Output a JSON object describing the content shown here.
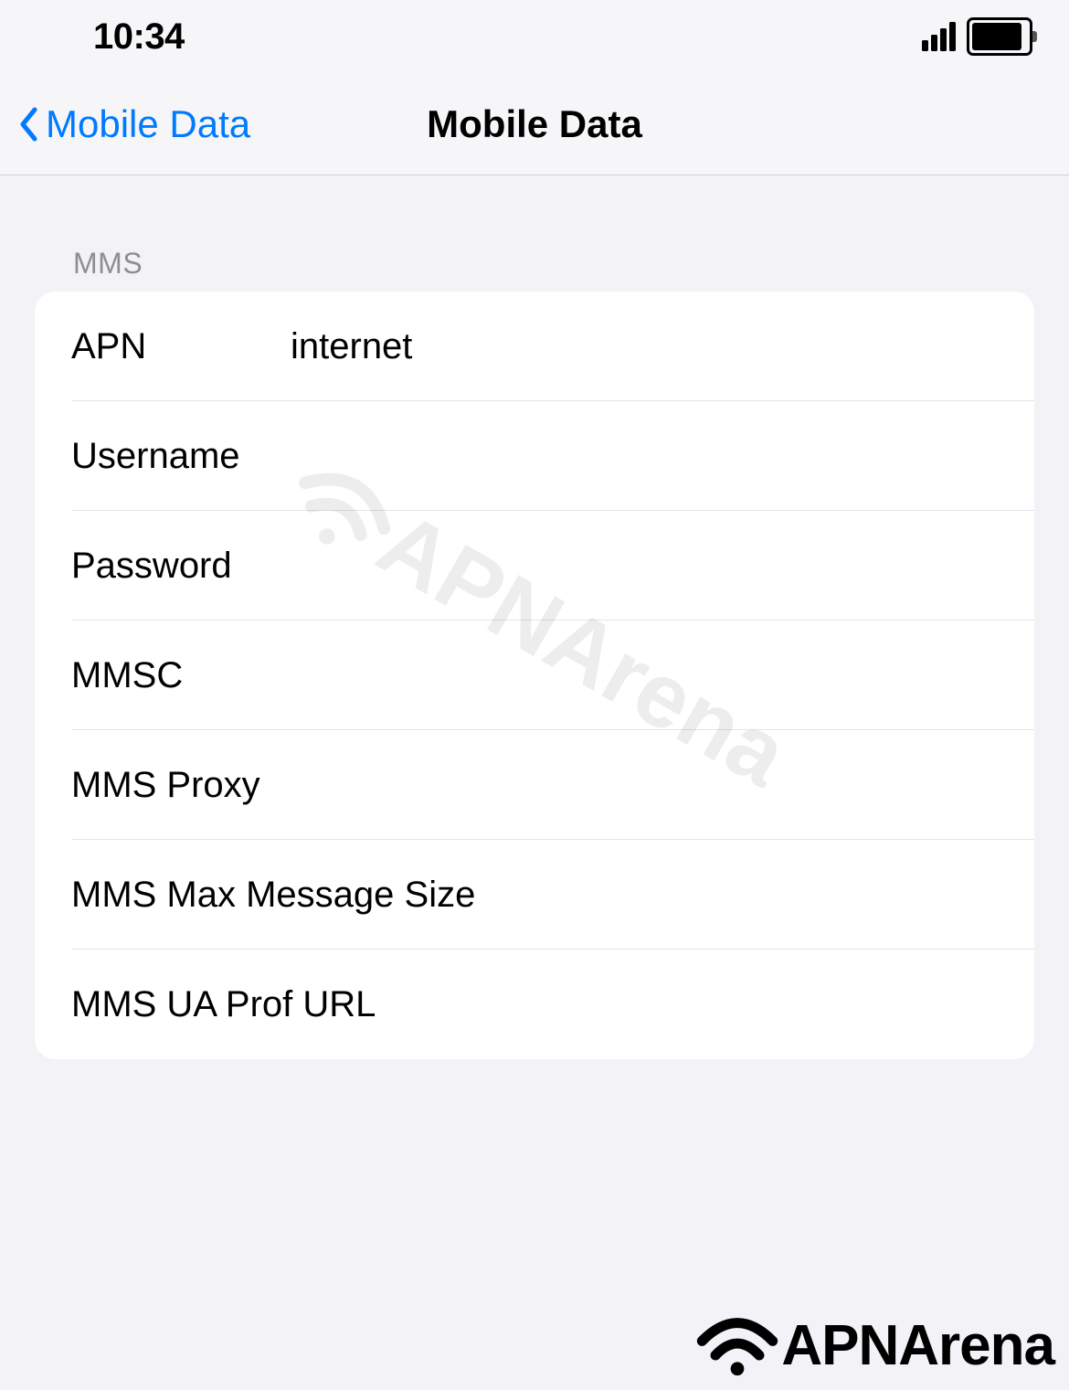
{
  "statusBar": {
    "time": "10:34"
  },
  "nav": {
    "backLabel": "Mobile Data",
    "title": "Mobile Data"
  },
  "section": {
    "header": "MMS",
    "rows": {
      "apn": {
        "label": "APN",
        "value": "internet"
      },
      "username": {
        "label": "Username",
        "value": ""
      },
      "password": {
        "label": "Password",
        "value": ""
      },
      "mmsc": {
        "label": "MMSC",
        "value": ""
      },
      "mmsProxy": {
        "label": "MMS Proxy",
        "value": ""
      },
      "mmsMax": {
        "label": "MMS Max Message Size",
        "value": ""
      },
      "mmsUa": {
        "label": "MMS UA Prof URL",
        "value": ""
      }
    }
  },
  "branding": {
    "watermark": "APNArena",
    "footer": "APNArena"
  }
}
